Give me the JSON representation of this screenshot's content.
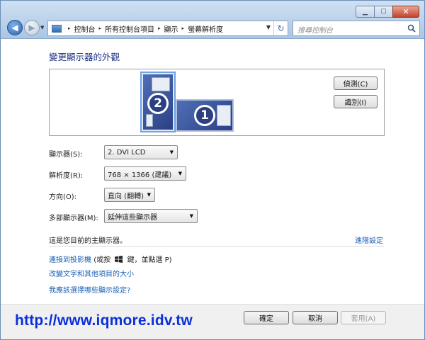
{
  "window": {
    "caption_buttons": {
      "minimize": "▁",
      "maximize": "☐",
      "close": "✕"
    }
  },
  "nav": {
    "back_icon": "arrow-left-icon",
    "forward_icon": "arrow-right-icon",
    "back_glyph": "◀",
    "forward_glyph": "▶",
    "recent_glyph": "▼"
  },
  "address_bar": {
    "separator": "▸",
    "crumbs": [
      "控制台",
      "所有控制台項目",
      "顯示",
      "螢幕解析度"
    ],
    "dropdown_glyph": "▼",
    "refresh_glyph": "↻"
  },
  "search": {
    "placeholder": "搜尋控制台"
  },
  "page": {
    "heading": "變更顯示器的外觀",
    "preview": {
      "monitor_2_number": "2",
      "monitor_1_number": "1",
      "detect_button": "偵測(C)",
      "identify_button": "識別(I)"
    },
    "settings": {
      "display_label": "顯示器(S):",
      "display_value": "2. DVI LCD",
      "resolution_label": "解析度(R):",
      "resolution_value": "768 × 1366 (建議)",
      "orientation_label": "方向(O):",
      "orientation_value": "直向 (翻轉)",
      "multiple_label": "多部顯示器(M):",
      "multiple_value": "延伸這些顯示器",
      "dropdown_glyph": "▼"
    },
    "main_display_note": "這是您目前的主顯示器。",
    "advanced_link": "進階設定",
    "links": {
      "projector_prefix": "連接到投影機",
      "projector_suffix_a": "(或按",
      "projector_suffix_b": "鍵，並點選 P)",
      "text_size": "改變文字和其他項目的大小",
      "which_settings": "我應該選擇哪些顯示設定?"
    }
  },
  "footer": {
    "ok": "確定",
    "cancel": "取消",
    "apply": "套用(A)"
  },
  "watermark": "http://www.iqmore.idv.tw",
  "colors": {
    "link": "#1a5fb4",
    "heading": "#1e3287",
    "watermark": "#0a2fd9"
  }
}
